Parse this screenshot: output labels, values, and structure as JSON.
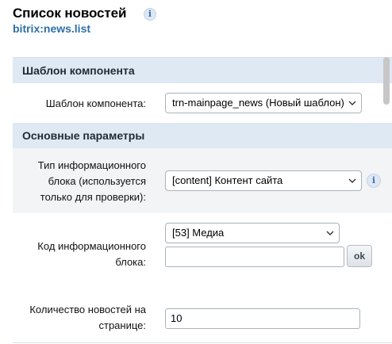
{
  "header": {
    "title": "Список новостей",
    "info_icon": "i",
    "component_code": "bitrix:news.list"
  },
  "sections": {
    "template": {
      "title": "Шаблон компонента",
      "template_label": "Шаблон компонента:",
      "template_value": "trn-mainpage_news (Новый шаблон)"
    },
    "main": {
      "title": "Основные параметры",
      "iblock_type_label_lines": [
        "Тип информационного",
        "блока (используется",
        "только для проверки):"
      ],
      "iblock_type_value": "[content] Контент сайта",
      "iblock_type_info": "i",
      "iblock_code_label_lines": [
        "Код информационного",
        "блока:"
      ],
      "iblock_code_value": "[53] Медиа",
      "iblock_code_input": "",
      "ok_label": "ok",
      "news_count_label_lines": [
        "Количество новостей на",
        "странице:"
      ],
      "news_count_value": "10"
    }
  },
  "colors": {
    "section_bg": "#dfe9f4",
    "alt_row_bg": "#f3f4f5",
    "link_blue": "#2f6fa7"
  },
  "icons": [
    "info-icon",
    "chevron-down-icon"
  ]
}
